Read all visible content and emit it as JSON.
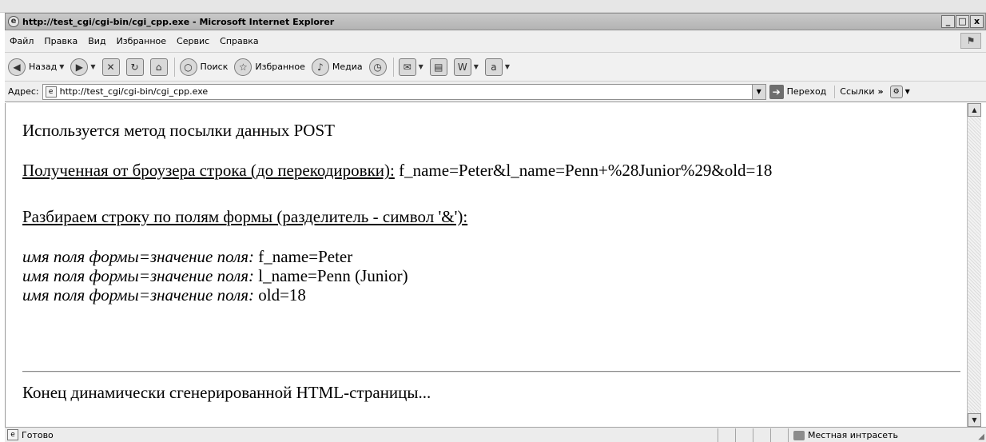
{
  "window": {
    "title": "http://test_cgi/cgi-bin/cgi_cpp.exe - Microsoft Internet Explorer",
    "min_label": "_",
    "max_label": "□",
    "close_label": "x"
  },
  "menu": {
    "items": [
      "Файл",
      "Правка",
      "Вид",
      "Избранное",
      "Сервис",
      "Справка"
    ]
  },
  "toolbar": {
    "back_label": "Назад",
    "search_label": "Поиск",
    "favorites_label": "Избранное",
    "media_label": "Медиа"
  },
  "address": {
    "label": "Адрес:",
    "value": "http://test_cgi/cgi-bin/cgi_cpp.exe",
    "go_label": "Переход",
    "links_label": "Ссылки"
  },
  "page": {
    "method_line": "Используется метод посылки данных POST",
    "received_label": "Полученная от броузера строка (до перекодировки):",
    "received_value": "f_name=Peter&l_name=Penn+%28Junior%29&old=18",
    "parse_heading": "Разбираем строку по полям формы (разделитель - символ '&'):",
    "field_prefix": "имя поля формы=значение поля:",
    "fields": [
      "f_name=Peter",
      "l_name=Penn (Junior)",
      "old=18"
    ],
    "footer_line": "Конец динамически сгенерированной HTML-страницы..."
  },
  "status": {
    "text": "Готово",
    "zone": "Местная интрасеть"
  }
}
